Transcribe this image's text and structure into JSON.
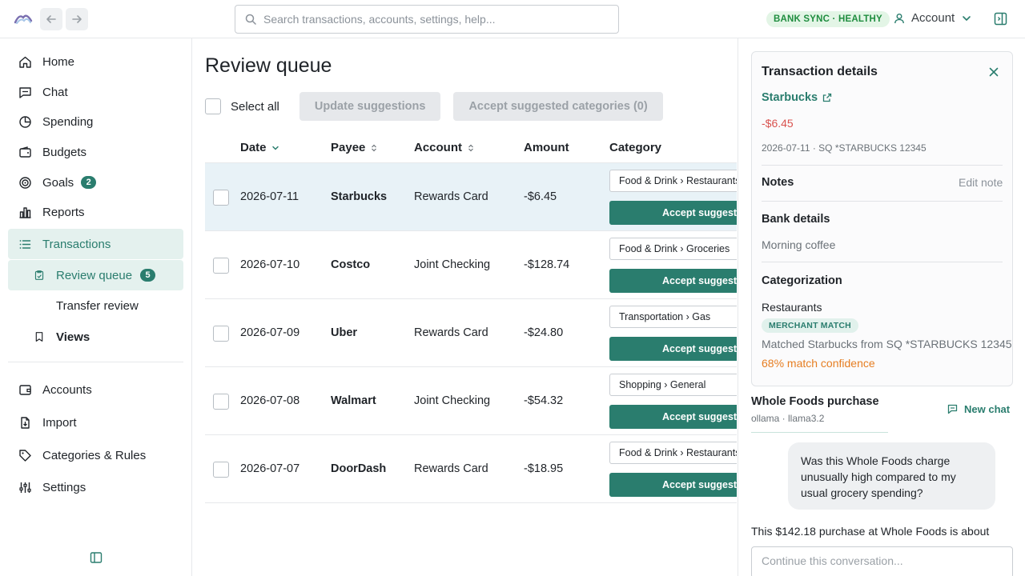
{
  "topbar": {
    "search_placeholder": "Search transactions, accounts, settings, help...",
    "bank_status": "BANK SYNC · HEALTHY",
    "account_label": "Account"
  },
  "sidebar": {
    "home": "Home",
    "chat": "Chat",
    "spending": "Spending",
    "budgets": "Budgets",
    "goals": "Goals",
    "goals_count": "2",
    "reports": "Reports",
    "transactions": "Transactions",
    "review_queue": "Review queue",
    "review_count": "5",
    "transfer_review": "Transfer review",
    "views": "Views",
    "accounts": "Accounts",
    "import": "Import",
    "categories_rules": "Categories & Rules",
    "settings": "Settings"
  },
  "main": {
    "title": "Review queue",
    "select_all": "Select all",
    "update_suggestions": "Update suggestions",
    "accept_categories": "Accept suggested categories (0)",
    "columns": {
      "date": "Date",
      "payee": "Payee",
      "account": "Account",
      "amount": "Amount",
      "category": "Category"
    },
    "accept_label": "Accept suggestion",
    "rows": [
      {
        "date": "2026-07-11",
        "payee": "Starbucks",
        "account": "Rewards Card",
        "amount": "-$6.45",
        "category": "Food & Drink › Restaurants"
      },
      {
        "date": "2026-07-10",
        "payee": "Costco",
        "account": "Joint Checking",
        "amount": "-$128.74",
        "category": "Food & Drink › Groceries"
      },
      {
        "date": "2026-07-09",
        "payee": "Uber",
        "account": "Rewards Card",
        "amount": "-$24.80",
        "category": "Transportation › Gas"
      },
      {
        "date": "2026-07-08",
        "payee": "Walmart",
        "account": "Joint Checking",
        "amount": "-$54.32",
        "category": "Shopping › General"
      },
      {
        "date": "2026-07-07",
        "payee": "DoorDash",
        "account": "Rewards Card",
        "amount": "-$18.95",
        "category": "Food & Drink › Restaurants"
      }
    ]
  },
  "details": {
    "title": "Transaction details",
    "payee": "Starbucks",
    "amount": "-$6.45",
    "meta": "2026-07-11 · SQ *STARBUCKS 12345",
    "notes_heading": "Notes",
    "edit_note": "Edit note",
    "bank_heading": "Bank details",
    "bank_text": "Morning coffee",
    "categorization_heading": "Categorization",
    "category": "Restaurants",
    "match_badge": "MERCHANT MATCH",
    "matched_text": "Matched Starbucks from SQ *STARBUCKS 12345",
    "confidence": "68% match confidence"
  },
  "chat": {
    "title": "Whole Foods purchase",
    "model": "ollama · llama3.2",
    "new_chat": "New chat",
    "user_message": "Was this Whole Foods charge unusually high compared to my usual grocery spending?",
    "assistant_message": "This $142.18 purchase at Whole Foods is about",
    "input_placeholder": "Continue this conversation..."
  }
}
